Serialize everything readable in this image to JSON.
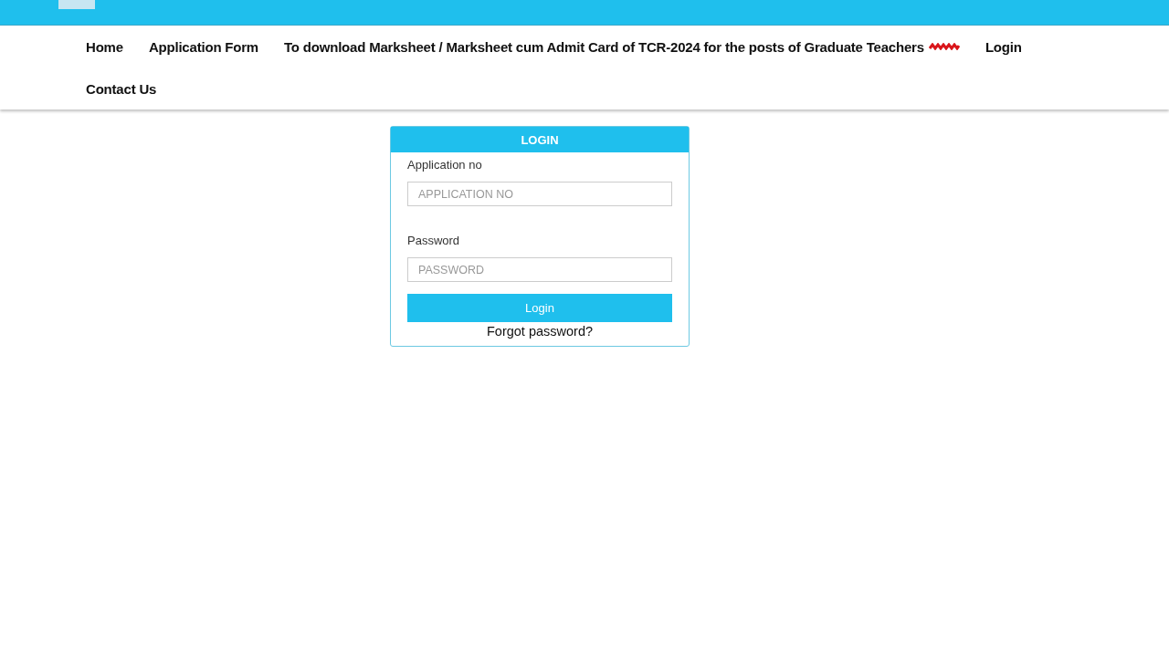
{
  "nav": [
    {
      "label": "Home",
      "badge": false
    },
    {
      "label": "Application Form",
      "badge": false
    },
    {
      "label": "To download Marksheet / Marksheet cum Admit Card of TCR-2024 for the posts of Graduate Teachers",
      "badge": true
    },
    {
      "label": "Login",
      "badge": false
    },
    {
      "label": "Contact Us",
      "badge": false
    }
  ],
  "login_panel": {
    "title": "LOGIN",
    "fields": [
      {
        "label": "Application no",
        "placeholder": "APPLICATION NO"
      },
      {
        "label": "Password",
        "placeholder": "PASSWORD"
      }
    ],
    "button": "Login",
    "forgot_link": "Forgot password?"
  }
}
